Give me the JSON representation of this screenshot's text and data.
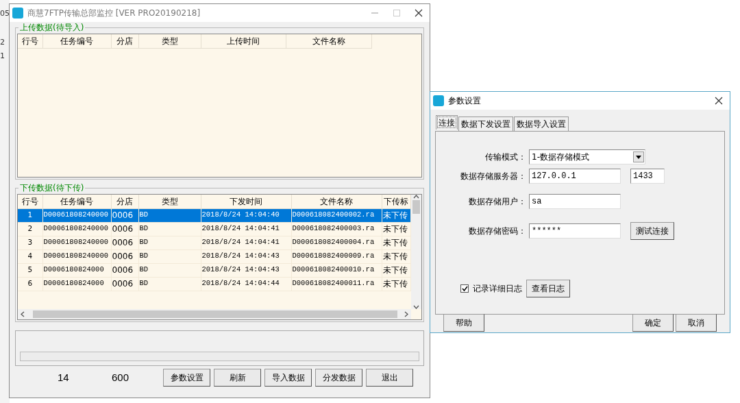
{
  "background_fragments": [
    "05",
    "2",
    "1"
  ],
  "main_window": {
    "title": "商慧7FTP传输总部监控 [VER PRO20190218]",
    "upload_group": {
      "title": "上传数据(待导入)",
      "columns": [
        "行号",
        "任务编号",
        "分店",
        "类型",
        "上传时间",
        "文件名称"
      ]
    },
    "download_group": {
      "title": "下传数据(待下传)",
      "columns": [
        "行号",
        "任务编号",
        "分店",
        "类型",
        "下发时间",
        "文件名称",
        "下传标"
      ],
      "rows": [
        {
          "selected": true,
          "cells": [
            "1",
            "D00061808240000",
            "0006",
            "BD",
            "2018/8/24 14:04:40",
            "D000618082400002.ra",
            "未下传"
          ]
        },
        {
          "selected": false,
          "cells": [
            "2",
            "D00061808240000",
            "0006",
            "BD",
            "2018/8/24 14:04:41",
            "D000618082400003.ra",
            "未下传"
          ]
        },
        {
          "selected": false,
          "cells": [
            "3",
            "D00061808240000",
            "0006",
            "BD",
            "2018/8/24 14:04:41",
            "D000618082400004.ra",
            "未下传"
          ]
        },
        {
          "selected": false,
          "cells": [
            "4",
            "D00061808240000",
            "0006",
            "BD",
            "2018/8/24 14:04:43",
            "D000618082400009.ra",
            "未下传"
          ]
        },
        {
          "selected": false,
          "cells": [
            "5",
            "D0006180824000",
            "0006",
            "BD",
            "2018/8/24 14:04:43",
            "D000618082400010.ra",
            "未下传"
          ]
        },
        {
          "selected": false,
          "cells": [
            "6",
            "D0006180824000",
            "0006",
            "BD",
            "2018/8/24 14:04:44",
            "D000618082400011.ra",
            "未下传"
          ]
        }
      ]
    },
    "progress": {
      "level": 0
    },
    "counts": [
      "14",
      "600"
    ],
    "buttons": [
      "参数设置",
      "刷新",
      "导入数据",
      "分发数据",
      "退出"
    ]
  },
  "dialog": {
    "title": "参数设置",
    "tabs": [
      {
        "label": "连接",
        "selected": true
      },
      {
        "label": "数据下发设置",
        "selected": false
      },
      {
        "label": "数据导入设置",
        "selected": false
      }
    ],
    "fields": [
      {
        "kind": "select",
        "label": "传输模式：",
        "value": "1-数据存储模式"
      },
      {
        "kind": "text",
        "label": "数据存储服务器：",
        "value": "127.0.0.1",
        "extra": "1433"
      },
      {
        "kind": "text",
        "label": "数据存储用户：",
        "value": "sa"
      },
      {
        "kind": "text",
        "label": "数据存储密码：",
        "value": "******",
        "button": "测试连接"
      }
    ],
    "log": {
      "label": "记录详细日志",
      "checked": true,
      "button": "查看日志"
    },
    "buttons_left": [
      "帮助"
    ],
    "buttons_right": [
      "确定",
      "取消"
    ]
  }
}
